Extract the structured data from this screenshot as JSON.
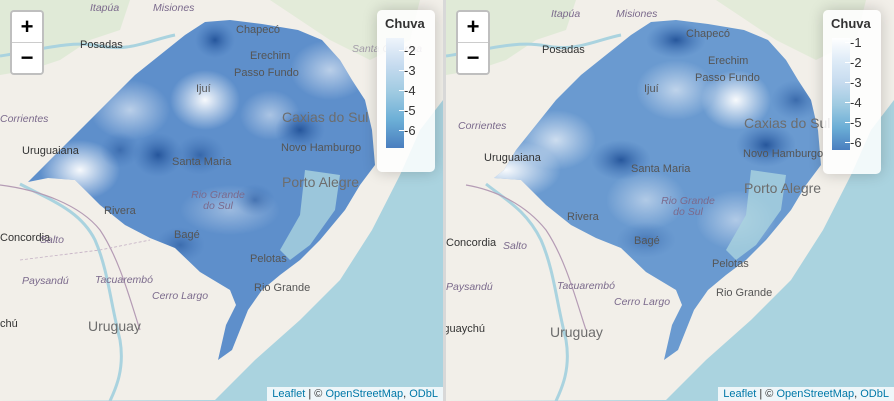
{
  "maps": [
    {
      "zoom_in": "+",
      "zoom_out": "−",
      "legend": {
        "title": "Chuva",
        "ticks": [
          "-2",
          "-3",
          "-4",
          "-5",
          "-6"
        ]
      },
      "attribution": {
        "leaflet": "Leaflet",
        "sep": " | © ",
        "osm": "OpenStreetMap",
        "odbl": "ODbL"
      },
      "labels": {
        "itapua": "Itapúa",
        "misiones": "Misiones",
        "posadas": "Posadas",
        "chapeco": "Chapecó",
        "erechim": "Erechim",
        "passo_fundo": "Passo Fundo",
        "santa_catarina": "Santa Catarina",
        "ijui": "Ijuí",
        "corrientes": "Corrientes",
        "caxias": "Caxias do Sul",
        "uruguaiana": "Uruguaiana",
        "santa_maria": "Santa Maria",
        "novo_hamburgo": "Novo Hamburgo",
        "porto_alegre": "Porto Alegre",
        "rio_grande_do_sul": "Rio Grande do Sul",
        "rivera": "Rivera",
        "concordia": "Concordia",
        "salto": "Salto",
        "bage": "Bagé",
        "paysandu": "Paysandú",
        "tacuarembo": "Tacuarembó",
        "pelotas": "Pelotas",
        "rio_grande": "Rio Grande",
        "cerro_largo": "Cerro Largo",
        "uruguay": "Uruguay",
        "quaychu": "chú"
      }
    },
    {
      "zoom_in": "+",
      "zoom_out": "−",
      "legend": {
        "title": "Chuva",
        "ticks": [
          "-1",
          "-2",
          "-3",
          "-4",
          "-5",
          "-6"
        ]
      },
      "attribution": {
        "leaflet": "Leaflet",
        "sep": " | © ",
        "osm": "OpenStreetMap",
        "odbl": "ODbL"
      },
      "labels": {
        "itapua": "Itapúa",
        "misiones": "Misiones",
        "posadas": "Posadas",
        "chapeco": "Chapecó",
        "erechim": "Erechim",
        "passo_fundo": "Passo Fundo",
        "ijui": "Ijuí",
        "corrientes": "Corrientes",
        "caxias": "Caxias do Sul",
        "uruguaiana": "Uruguaiana",
        "santa_maria": "Santa Maria",
        "novo_hamburgo": "Novo Hamburgo",
        "porto_alegre": "Porto Alegre",
        "rio_grande_do_sul": "Rio Grande do Sul",
        "rivera": "Rivera",
        "concordia": "Concordia",
        "salto": "Salto",
        "bage": "Bagé",
        "paysandu": "Paysandú",
        "tacuarembo": "Tacuarembó",
        "pelotas": "Pelotas",
        "rio_grande": "Rio Grande",
        "cerro_largo": "Cerro Largo",
        "uruguay": "Uruguay",
        "gualeguaychu": "Gualeguaychú"
      }
    }
  ]
}
